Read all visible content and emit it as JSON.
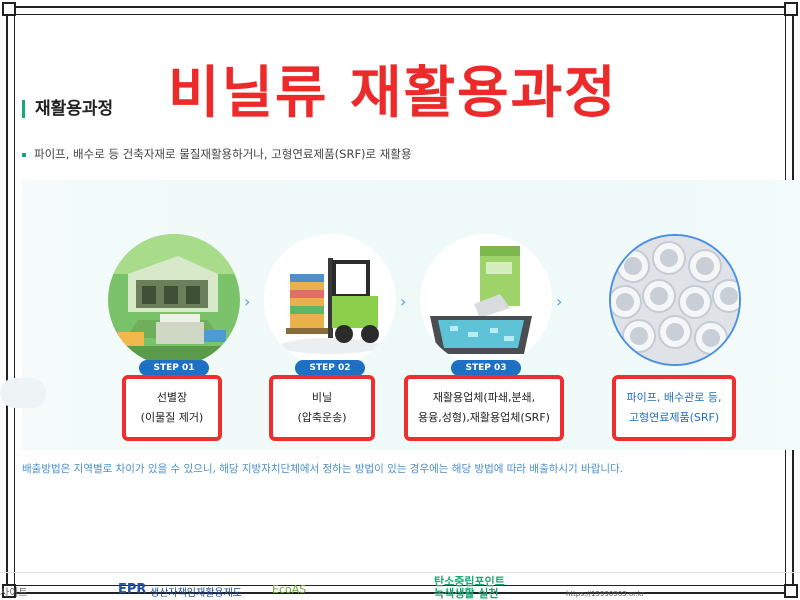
{
  "overlay": {
    "title": "비닐류 재활용과정"
  },
  "section": {
    "title": "재활용과정",
    "description": "파이프, 배수로 등 건축자재로 물질재활용하거나, 고형연료제품(SRF)로 재활용"
  },
  "steps": [
    {
      "badge": "STEP 01",
      "line1": "선별장",
      "line2": "(이물질 제거)"
    },
    {
      "badge": "STEP 02",
      "line1": "비닐",
      "line2": "(압축운송)"
    },
    {
      "badge": "STEP 03",
      "line1": "재활용업체(파쇄,분쇄,",
      "line2": "용융,성형),재활용업체(SRF)"
    }
  ],
  "result": {
    "line1": "파이프, 배수관로 등,",
    "line2": "고형연료제품(SRF)"
  },
  "notice": "배출방법은 지역별로 차이가 있을 수 있으니, 해당 지방자치단체에서 정하는 방법이 있는 경우에는 해당 방법에 따라 배출하시기 바랍니다.",
  "footer": {
    "left_text": "사이트",
    "epr_mark": "EPR",
    "epr_name": "생산자책임재활용제도",
    "ecoas": "EcoAS",
    "carbon_line1": "탄소중립포인트",
    "carbon_line2": "녹색생활 실천",
    "url": "https://15990903.or.kr"
  },
  "colors": {
    "accent_red": "#ef2f2f",
    "accent_blue": "#1f6fc2",
    "accent_green": "#19a974"
  }
}
